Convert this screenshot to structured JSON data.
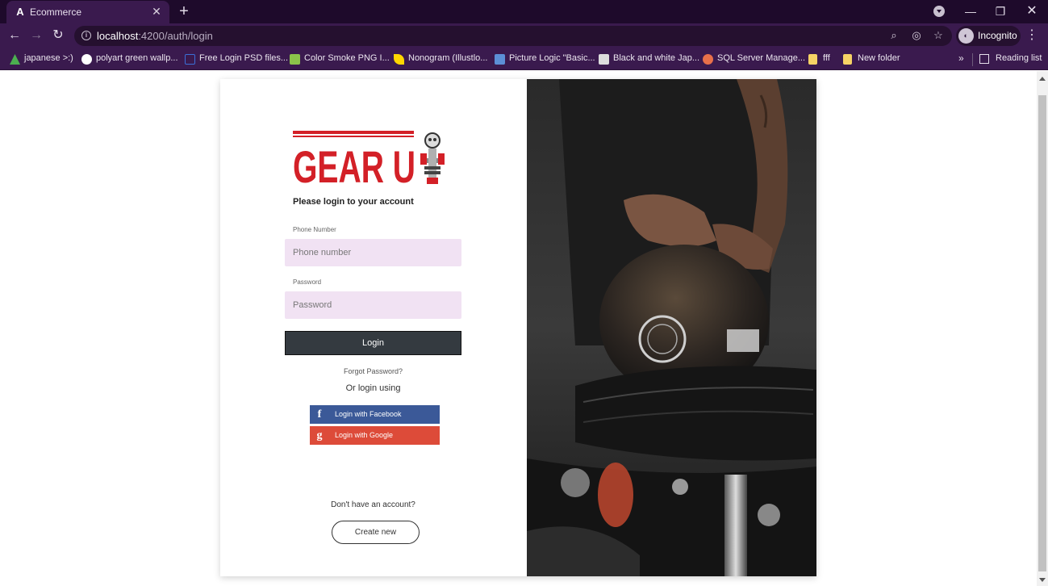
{
  "browser": {
    "tab_title": "Ecommerce",
    "tab_favicon": "A",
    "url_host": "localhost",
    "url_path": ":4200/auth/login",
    "incognito_label": "Incognito",
    "reading_list": "Reading list",
    "bookmarks_more": "»",
    "bookmarks": [
      {
        "label": "japanese >:)",
        "icon": "drive-icon",
        "color": "#4caf50"
      },
      {
        "label": "polyart green wallp...",
        "icon": "google-icon",
        "color": "#ffffff"
      },
      {
        "label": "Free Login PSD files...",
        "icon": "square-icon",
        "color": "#3b6fd6"
      },
      {
        "label": "Color Smoke PNG I...",
        "icon": "image-icon",
        "color": "#8bc34a"
      },
      {
        "label": "Nonogram (Illustlo...",
        "icon": "leaf-icon",
        "color": "#ffd600"
      },
      {
        "label": "Picture Logic \"Basic...",
        "icon": "puzzle-icon",
        "color": "#5c8fd6"
      },
      {
        "label": "Black and white Jap...",
        "icon": "gate-icon",
        "color": "#dddddd"
      },
      {
        "label": "SQL Server Manage...",
        "icon": "sql-icon",
        "color": "#e8704a"
      },
      {
        "label": "fff",
        "icon": "folder-icon",
        "color": "#f6d365"
      },
      {
        "label": "New folder",
        "icon": "folder-icon",
        "color": "#f6d365"
      }
    ]
  },
  "login": {
    "logo_text": "GEAR U",
    "subtitle": "Please login to your account",
    "phone_label": "Phone Number",
    "phone_placeholder": "Phone number",
    "phone_value": "",
    "password_label": "Password",
    "password_placeholder": "Password",
    "password_value": "",
    "login_button": "Login",
    "forgot": "Forgot Password?",
    "or_login": "Or login using",
    "facebook": "Login with Facebook",
    "google": "Login with Google",
    "no_account": "Don't have an account?",
    "create_new": "Create new"
  },
  "colors": {
    "brand_red": "#d32027",
    "facebook": "#3b5998",
    "google": "#dd4b39",
    "input_bg": "#f1e2f3",
    "login_btn": "#343a40",
    "chrome": "#3a1a4e"
  }
}
